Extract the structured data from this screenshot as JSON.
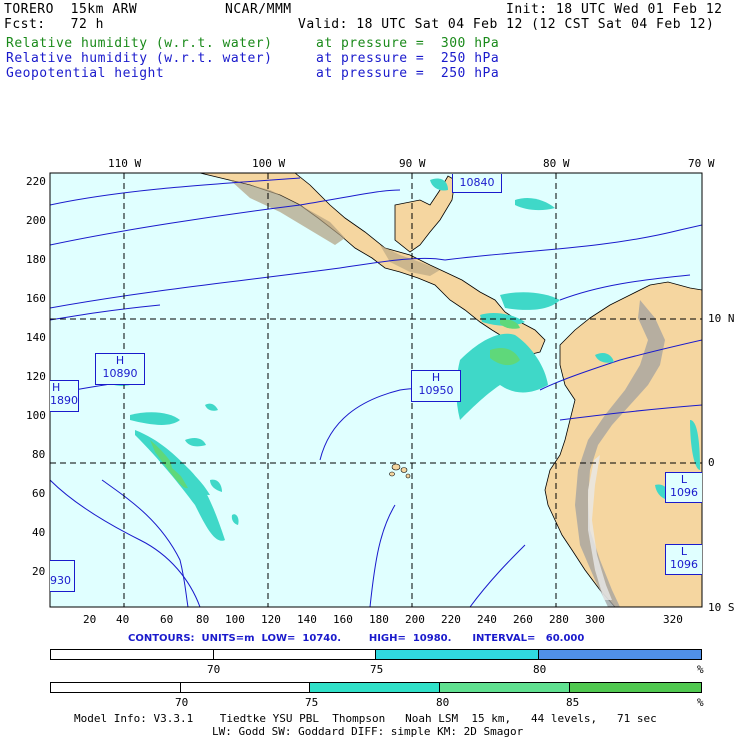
{
  "header": {
    "left1": "TORERO  15km ARW",
    "center1": "NCAR/MMM",
    "right1": "Init: 18 UTC Wed 01 Feb 12",
    "left2": "Fcst:   72 h",
    "right2": "Valid: 18 UTC Sat 04 Feb 12 (12 CST Sat 04 Feb 12)",
    "fields": [
      {
        "name": "Relative humidity (w.r.t. water)",
        "level": "at pressure =  300 hPa",
        "color": "#1a8a1a"
      },
      {
        "name": "Relative humidity (w.r.t. water)",
        "level": "at pressure =  250 hPa",
        "color": "#1a1acc"
      },
      {
        "name": "Geopotential height",
        "level": "at pressure =  250 hPa",
        "color": "#1a8a1a"
      }
    ]
  },
  "map": {
    "lon_labels": [
      "110 W",
      "100 W",
      "90 W",
      "80 W",
      "70 W"
    ],
    "lat_labels": [
      "10 N",
      "0",
      "10 S"
    ],
    "y_grid_labels": [
      "220",
      "200",
      "180",
      "160",
      "140",
      "120",
      "100",
      "80",
      "60",
      "40",
      "20"
    ],
    "x_grid_labels": [
      "20",
      "40",
      "60",
      "80",
      "100",
      "120",
      "140",
      "160",
      "180",
      "200",
      "220",
      "240",
      "260",
      "280",
      "300",
      "320"
    ],
    "highs": [
      {
        "letter": "H",
        "value": "10890"
      },
      {
        "letter": "H",
        "value": "1890"
      },
      {
        "letter": "H",
        "value": "10950"
      },
      {
        "letter": "",
        "value": "10840"
      }
    ],
    "lows": [
      {
        "letter": "L",
        "value": "1096"
      },
      {
        "letter": "L",
        "value": "1096"
      }
    ],
    "edge_label_left": "930",
    "colors": {
      "ocean": "#e0ffff",
      "land": "#f5d6a0",
      "rh_cyan": "#3fd8c8",
      "rh_green": "#5fd87a",
      "contour": "#1a1acc"
    }
  },
  "contours_text": "CONTOURS:  UNITS=m  LOW=  10740.        HIGH=  10980.      INTERVAL=   60.000",
  "legend1": {
    "ticks": [
      "70",
      "75",
      "80"
    ],
    "unit": "%",
    "colors": [
      "#ffffff",
      "#ffffff",
      "#30d8e0",
      "#5090e8"
    ]
  },
  "legend2": {
    "ticks": [
      "70",
      "75",
      "80",
      "85"
    ],
    "unit": "%",
    "colors": [
      "#ffffff",
      "#ffffff",
      "#30e0c8",
      "#60e090",
      "#50c850"
    ]
  },
  "model_info": {
    "line1": "Model Info: V3.3.1    Tiedtke YSU PBL  Thompson   Noah LSM  15 km,   44 levels,   71 sec",
    "line2": "LW: Godd SW: Goddard DIFF: simple KM: 2D Smagor"
  }
}
